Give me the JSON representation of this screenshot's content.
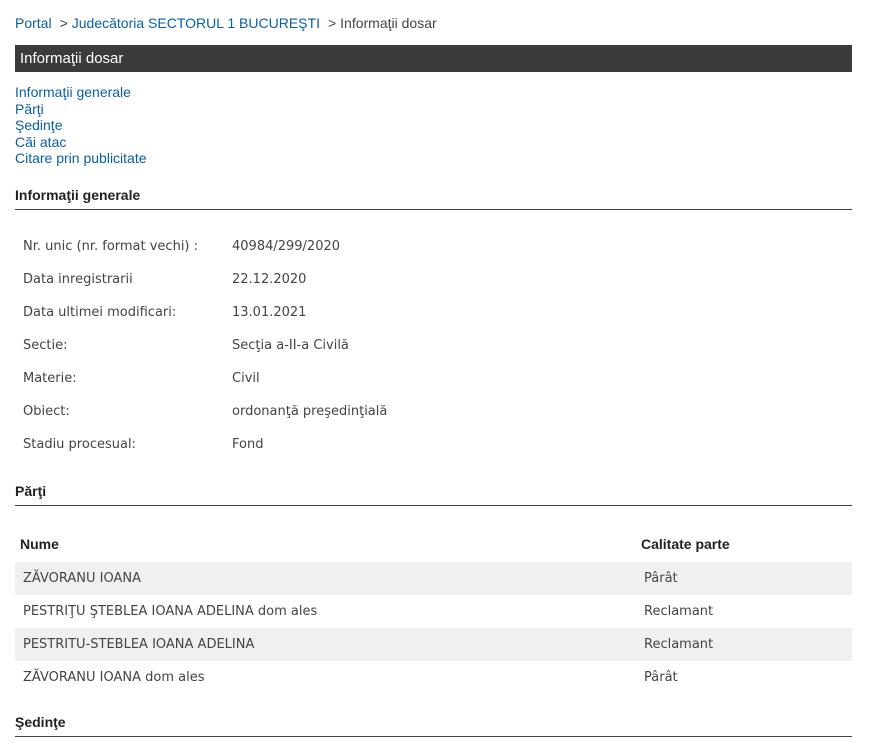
{
  "breadcrumb": {
    "portal": "Portal",
    "sep": ">",
    "court": "Judecătoria SECTORUL 1 BUCUREŞTI",
    "current": "Informaţii dosar"
  },
  "title": "Informaţii dosar",
  "anchors": [
    "Informaţii generale",
    "Părţi",
    "Şedinţe",
    "Căi atac",
    "Citare prin publicitate"
  ],
  "general": {
    "heading": "Informaţii generale",
    "rows": [
      {
        "label": "Nr. unic (nr. format vechi) :",
        "value": "40984/299/2020"
      },
      {
        "label": "Data inregistrarii",
        "value": "22.12.2020"
      },
      {
        "label": "Data ultimei modificari:",
        "value": "13.01.2021"
      },
      {
        "label": "Sectie:",
        "value": "Secţia a-II-a Civilă"
      },
      {
        "label": "Materie:",
        "value": "Civil"
      },
      {
        "label": "Obiect:",
        "value": "ordonanţă preşedinţială"
      },
      {
        "label": "Stadiu procesual:",
        "value": "Fond"
      }
    ]
  },
  "parti": {
    "heading": "Părţi",
    "columns": [
      "Nume",
      "Calitate parte"
    ],
    "rows": [
      [
        "ZĂVORANU IOANA",
        "Pârât"
      ],
      [
        "PESTRIŢU ŞTEBLEA IOANA ADELINA dom ales",
        "Reclamant"
      ],
      [
        "PESTRITU-STEBLEA IOANA ADELINA",
        "Reclamant"
      ],
      [
        "ZĂVORANU IOANA dom ales",
        "Pârât"
      ]
    ]
  },
  "sedinte": {
    "heading": "Şedinţe"
  },
  "colors": {
    "link": "#0b5fa5",
    "titlebar": "#3b3b3b",
    "row_alt": "#f0f0f0"
  }
}
